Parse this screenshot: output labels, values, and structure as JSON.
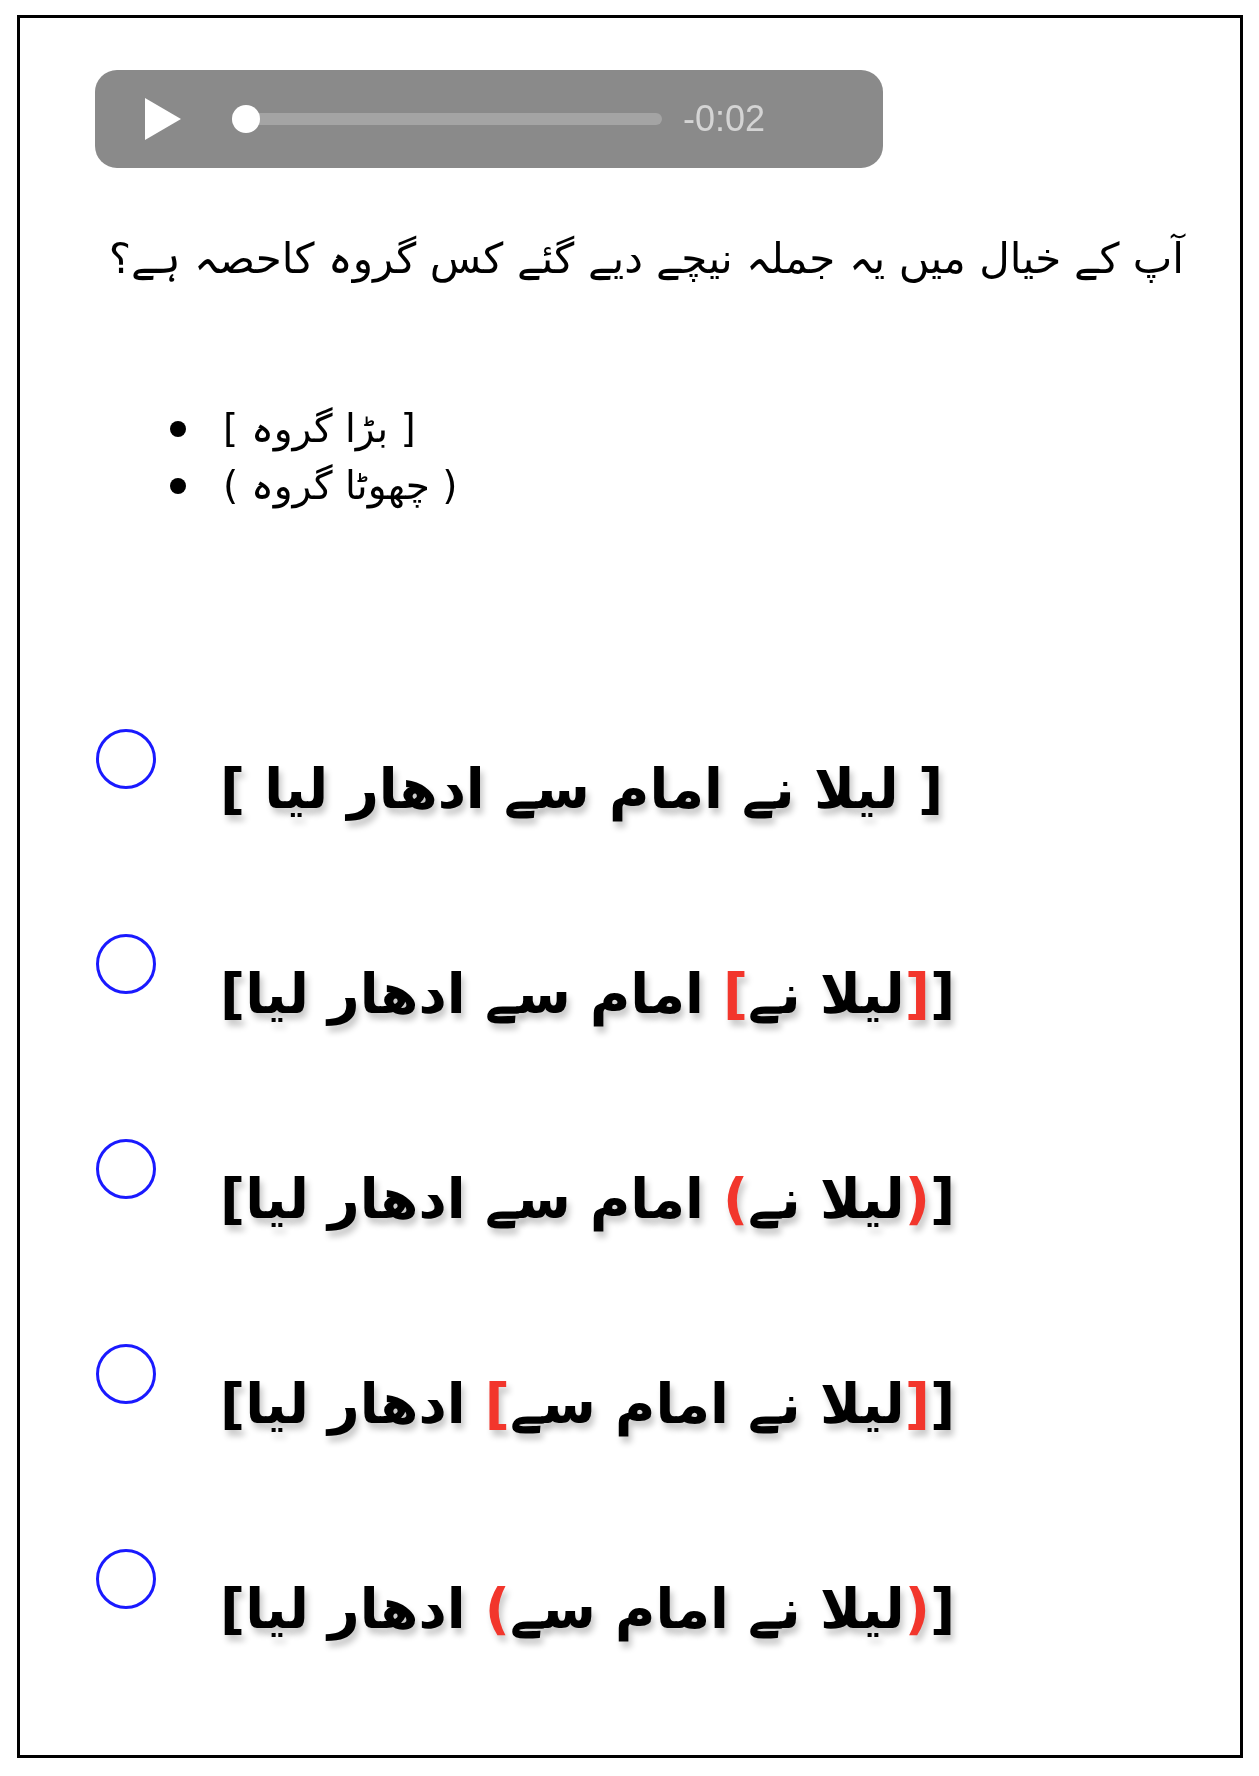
{
  "audio": {
    "time": "-0:02",
    "level": 0
  },
  "question": "آپ کے خیال میں یہ جملہ نیچے دیے گئے کس گروہ کاحصہ ہے؟",
  "list_items": [
    "[ بڑا گروہ ]",
    "( چھوٹا گروہ )"
  ],
  "options": [
    {
      "selected": false,
      "segments": [
        {
          "text": "[ لیلا نے امام سے ادھار لیا  ]",
          "highlighted": false
        }
      ]
    },
    {
      "selected": false,
      "segments": [
        {
          "text": "[",
          "highlighted": false
        },
        {
          "text": "[",
          "highlighted": true
        },
        {
          "text": "لیلا نے",
          "highlighted": false
        },
        {
          "text": "]",
          "highlighted": true
        },
        {
          "text": " امام سے ادھار لیا",
          "highlighted": false
        },
        {
          "text": "]",
          "highlighted": false
        }
      ]
    },
    {
      "selected": false,
      "segments": [
        {
          "text": "[",
          "highlighted": false
        },
        {
          "text": "(",
          "highlighted": true
        },
        {
          "text": "لیلا نے",
          "highlighted": false
        },
        {
          "text": ")",
          "highlighted": true
        },
        {
          "text": " امام سے ادھار لیا",
          "highlighted": false
        },
        {
          "text": "]",
          "highlighted": false
        }
      ]
    },
    {
      "selected": false,
      "segments": [
        {
          "text": "[",
          "highlighted": false
        },
        {
          "text": "[",
          "highlighted": true
        },
        {
          "text": "لیلا نے امام سے",
          "highlighted": false
        },
        {
          "text": "]",
          "highlighted": true
        },
        {
          "text": " ادھار لیا",
          "highlighted": false
        },
        {
          "text": "]",
          "highlighted": false
        }
      ]
    },
    {
      "selected": false,
      "segments": [
        {
          "text": "[",
          "highlighted": false
        },
        {
          "text": "(",
          "highlighted": true
        },
        {
          "text": "لیلا نے امام سے",
          "highlighted": false
        },
        {
          "text": ")",
          "highlighted": true
        },
        {
          "text": " ادھار لیا",
          "highlighted": false
        },
        {
          "text": "]",
          "highlighted": false
        }
      ]
    }
  ]
}
